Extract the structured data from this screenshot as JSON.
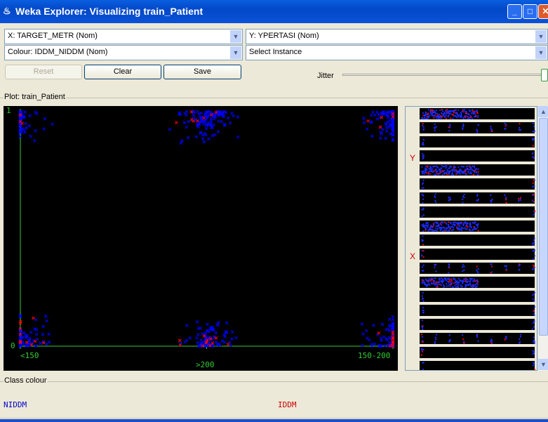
{
  "window": {
    "title": "Weka Explorer: Visualizing train_Patient",
    "buttons": [
      "_",
      "□",
      "✕"
    ]
  },
  "controls": {
    "x_axis": "X: TARGET_METR (Nom)",
    "y_axis": "Y: YPERTASI (Nom)",
    "colour": "Colour: IDDM_NIDDM (Nom)",
    "select_instance": "Select Instance",
    "reset": "Reset",
    "clear": "Clear",
    "save": "Save",
    "jitter_label": "Jitter",
    "jitter_value": 1.0
  },
  "plot": {
    "group_label": "Plot: train_Patient"
  },
  "chart_data": {
    "type": "scatter",
    "x_categories": [
      "<150",
      ">200",
      "150-200"
    ],
    "y_ticks": [
      "0",
      "1"
    ],
    "jitter": true,
    "series": [
      {
        "name": "NIDDM",
        "color": "#0000ff",
        "counts": {
          "<150|0": 70,
          ">200|0": 80,
          "150-200|0": 80,
          "<150|1": 60,
          ">200|1": 120,
          "150-200|1": 110
        }
      },
      {
        "name": "IDDM",
        "color": "#ff0000",
        "counts": {
          "<150|0": 12,
          ">200|0": 12,
          "150-200|0": 12,
          "<150|1": 3,
          ">200|1": 8,
          "150-200|1": 5
        }
      }
    ]
  },
  "side": {
    "y_marker": "Y",
    "x_marker": "X"
  },
  "class_colour": {
    "label": "Class colour",
    "classes": [
      {
        "name": "NIDDM",
        "color": "#0000ff"
      },
      {
        "name": "IDDM",
        "color": "#cc0000"
      }
    ]
  }
}
